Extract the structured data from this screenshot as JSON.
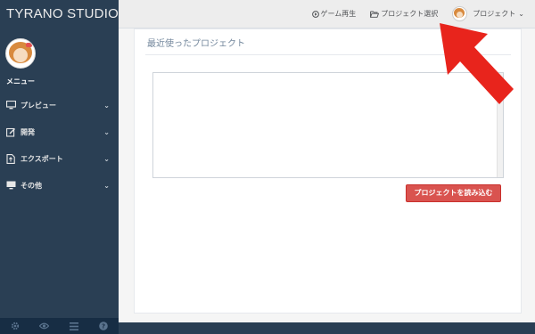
{
  "app": {
    "title": "TYRANO STUDIO"
  },
  "sidebar": {
    "menu_title": "メニュー",
    "items": [
      {
        "label": "プレビュー",
        "icon": "monitor-icon"
      },
      {
        "label": "開発",
        "icon": "edit-icon"
      },
      {
        "label": "エクスポート",
        "icon": "export-icon"
      },
      {
        "label": "その他",
        "icon": "desktop-icon"
      }
    ],
    "footer_icons": [
      "gear-icon",
      "eye-icon",
      "menu-icon",
      "help-icon"
    ]
  },
  "topbar": {
    "play_game": "ゲーム再生",
    "select_project": "プロジェクト選択",
    "user_menu": "プロジェクト"
  },
  "main": {
    "panel_title": "最近使ったプロジェクト",
    "load_button": "プロジェクトを読み込む"
  },
  "colors": {
    "sidebar": "#2a3f54",
    "accent_button": "#d9534f",
    "annotation_arrow": "#e8241c"
  }
}
